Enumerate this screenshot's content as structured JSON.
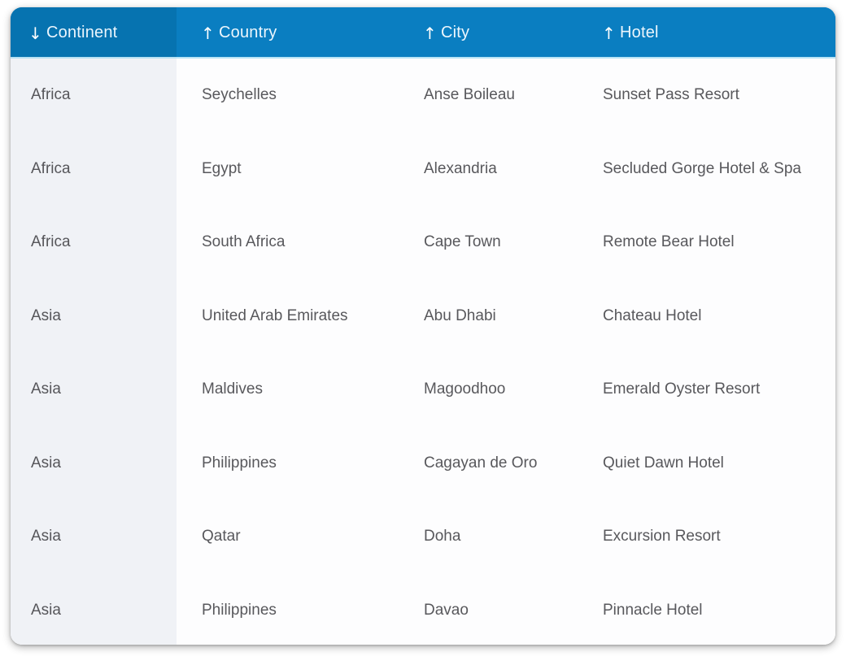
{
  "table": {
    "columns": [
      {
        "key": "continent",
        "label": "Continent",
        "sort": "desc",
        "sort_icon": "arrow-down-icon",
        "frozen": true
      },
      {
        "key": "country",
        "label": "Country",
        "sort": "asc",
        "sort_icon": "arrow-up-icon",
        "frozen": false
      },
      {
        "key": "city",
        "label": "City",
        "sort": "asc",
        "sort_icon": "arrow-up-icon",
        "frozen": false
      },
      {
        "key": "hotel",
        "label": "Hotel",
        "sort": "asc",
        "sort_icon": "arrow-up-icon",
        "frozen": false
      }
    ],
    "rows": [
      {
        "continent": "Africa",
        "country": "Seychelles",
        "city": "Anse Boileau",
        "hotel": "Sunset Pass Resort"
      },
      {
        "continent": "Africa",
        "country": "Egypt",
        "city": "Alexandria",
        "hotel": "Secluded Gorge Hotel & Spa"
      },
      {
        "continent": "Africa",
        "country": "South Africa",
        "city": "Cape Town",
        "hotel": "Remote Bear Hotel"
      },
      {
        "continent": "Asia",
        "country": "United Arab Emirates",
        "city": "Abu Dhabi",
        "hotel": "Chateau Hotel"
      },
      {
        "continent": "Asia",
        "country": "Maldives",
        "city": "Magoodhoo",
        "hotel": "Emerald Oyster Resort"
      },
      {
        "continent": "Asia",
        "country": "Philippines",
        "city": "Cagayan de Oro",
        "hotel": "Quiet Dawn Hotel"
      },
      {
        "continent": "Asia",
        "country": "Qatar",
        "city": "Doha",
        "hotel": "Excursion Resort"
      },
      {
        "continent": "Asia",
        "country": "Philippines",
        "city": "Davao",
        "hotel": "Pinnacle Hotel"
      }
    ]
  },
  "icons": {
    "arrow_up": "↑",
    "arrow_down": "↓"
  },
  "colors": {
    "header_blue": "#0a7ec1",
    "header_blue_frozen": "#0673b0",
    "header_text": "#ecf6fd",
    "frozen_column_bg": "#f0f2f6",
    "row_bg": "#fdfdfe",
    "row_divider": "#f2f3f5",
    "cell_text": "#58585c"
  }
}
